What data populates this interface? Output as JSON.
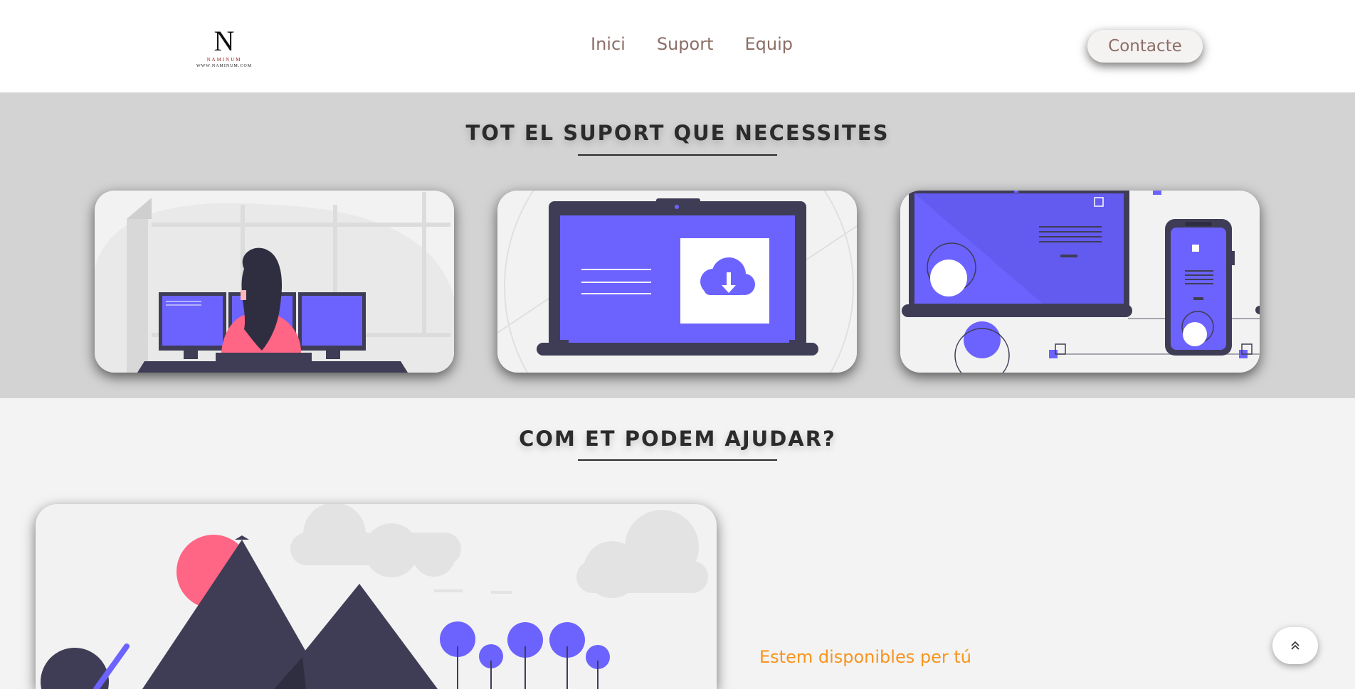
{
  "header": {
    "logo": {
      "letter": "N",
      "name": "NAMINUM",
      "url": "WWW.NAMINUM.COM"
    },
    "nav": [
      {
        "label": "Inici"
      },
      {
        "label": "Suport"
      },
      {
        "label": "Equip"
      }
    ],
    "contact_label": "Contacte"
  },
  "support_section": {
    "title": "TOT EL SUPORT QUE NECESSITES",
    "cards": [
      {
        "illustration": "woman-at-monitors-illustration"
      },
      {
        "illustration": "laptop-download-illustration"
      },
      {
        "illustration": "laptop-phone-illustration"
      }
    ]
  },
  "help_section": {
    "title": "COM ET PODEM AJUDAR?",
    "subtitle": "Estem disponibles per tú"
  },
  "scroll_top": {
    "icon": "double-chevron-up-icon"
  },
  "colors": {
    "accent": "#6c63ff",
    "dark": "#3f3d56",
    "pink": "#ff6584",
    "orange": "#f7941d",
    "nav_text": "#8b6e66"
  }
}
